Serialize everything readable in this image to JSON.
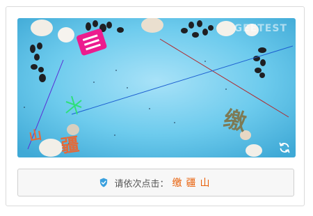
{
  "captcha": {
    "prompt": "请依次点击：",
    "targets": [
      "缴",
      "疆",
      "山"
    ],
    "watermark": "GEETEST",
    "image_chars": [
      "疆",
      "缴",
      "山"
    ]
  },
  "icons": {
    "refresh": "refresh-icon",
    "shield": "shield-check-icon"
  },
  "colors": {
    "background": "#6ac8ea",
    "target_text": "#e8600a",
    "prompt_text": "#555555",
    "char_orange": "#e36a3a",
    "char_olive": "#7d7a55",
    "char_pink": "#ec1c8e"
  }
}
